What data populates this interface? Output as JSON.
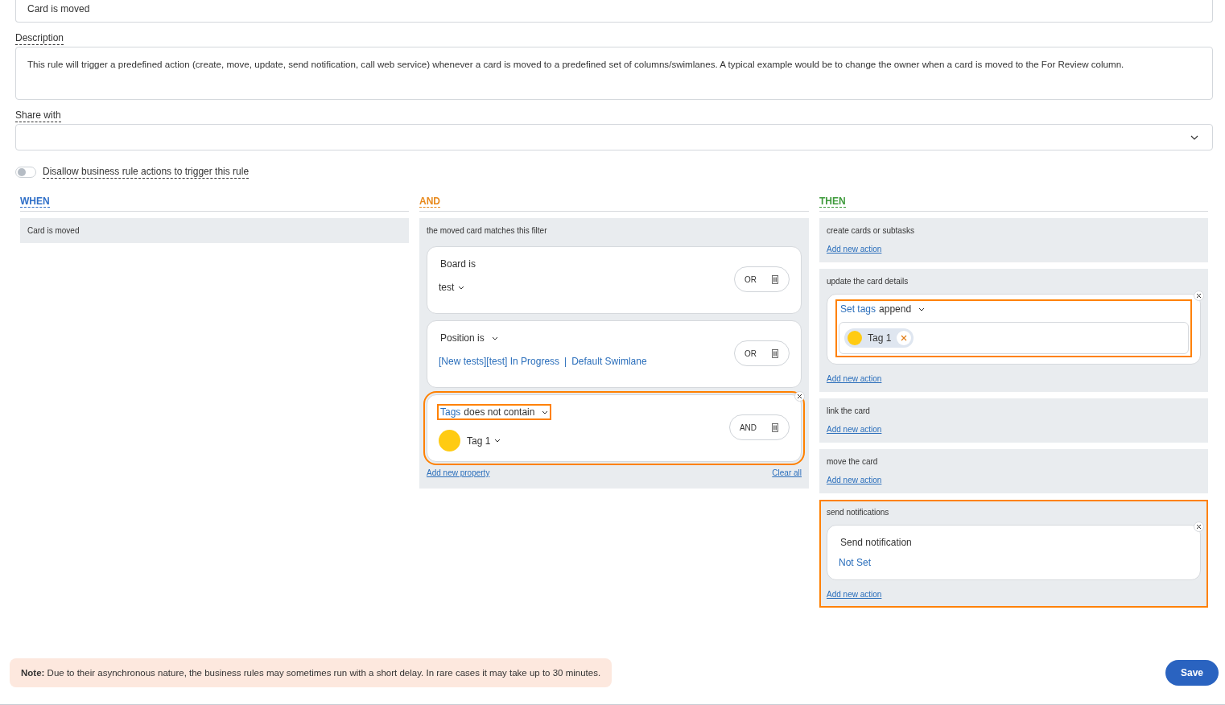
{
  "name_field": {
    "value": "Card is moved"
  },
  "description": {
    "label": "Description",
    "value": "This rule will trigger a predefined action (create, move, update, send notification, call web service) whenever a card is moved to a predefined set of columns/swimlanes. A typical example would be to change the owner when a card is moved to the For Review column."
  },
  "share_with": {
    "label": "Share with"
  },
  "toggle": {
    "label": "Disallow business rule actions to trigger this rule",
    "on": false
  },
  "when": {
    "title": "WHEN",
    "items": [
      "Card is moved"
    ]
  },
  "and": {
    "title": "AND",
    "subtitle": "the moved card matches this filter",
    "conditions": [
      {
        "kind": "text",
        "title_parts": [
          {
            "text": "Board is",
            "link": false
          }
        ],
        "title_dropdown": false,
        "title_highlighted": false,
        "value": "test",
        "value_dropdown": true,
        "operator": "OR",
        "removable": false,
        "highlighted": false
      },
      {
        "kind": "links",
        "title_parts": [
          {
            "text": "Position is",
            "link": false
          }
        ],
        "title_dropdown": true,
        "title_highlighted": false,
        "links": [
          "[New tests][test] In Progress",
          "Default Swimlane"
        ],
        "separator": "|",
        "operator": "OR",
        "removable": false,
        "highlighted": false
      },
      {
        "kind": "tag",
        "title_parts": [
          {
            "text": "Tags",
            "link": true
          },
          {
            "text": "does not contain",
            "link": false
          }
        ],
        "title_dropdown": true,
        "title_highlighted": true,
        "tag": {
          "label": "Tag 1",
          "color": "#ffcb12"
        },
        "value_dropdown": true,
        "operator": "AND",
        "removable": true,
        "highlighted": true
      }
    ],
    "add_link": "Add new property",
    "clear_link": "Clear all"
  },
  "then": {
    "title": "THEN",
    "sections": [
      {
        "title": "create cards or subtasks",
        "add_link": "Add new action",
        "highlighted": false
      },
      {
        "title": "update the card details",
        "actions": [
          {
            "kind": "tags",
            "title_parts": [
              {
                "text": "Set tags",
                "link": true
              },
              {
                "text": "append",
                "link": false
              }
            ],
            "dropdown": true,
            "tags": [
              {
                "label": "Tag 1",
                "color": "#ffcb12"
              }
            ],
            "highlighted": true
          }
        ],
        "add_link": "Add new action",
        "highlighted": false
      },
      {
        "title": "link the card",
        "add_link": "Add new action",
        "highlighted": false
      },
      {
        "title": "move the card",
        "add_link": "Add new action",
        "highlighted": false
      },
      {
        "title": "send notifications",
        "actions": [
          {
            "kind": "notification",
            "title": "Send notification",
            "value": "Not Set"
          }
        ],
        "add_link": "Add new action",
        "highlighted": true
      }
    ]
  },
  "note": "**Note:** Due to their asynchronous nature, the business rules may sometimes run with a short delay. In rare cases it may take up to 30 minutes.",
  "save_button": "Save"
}
